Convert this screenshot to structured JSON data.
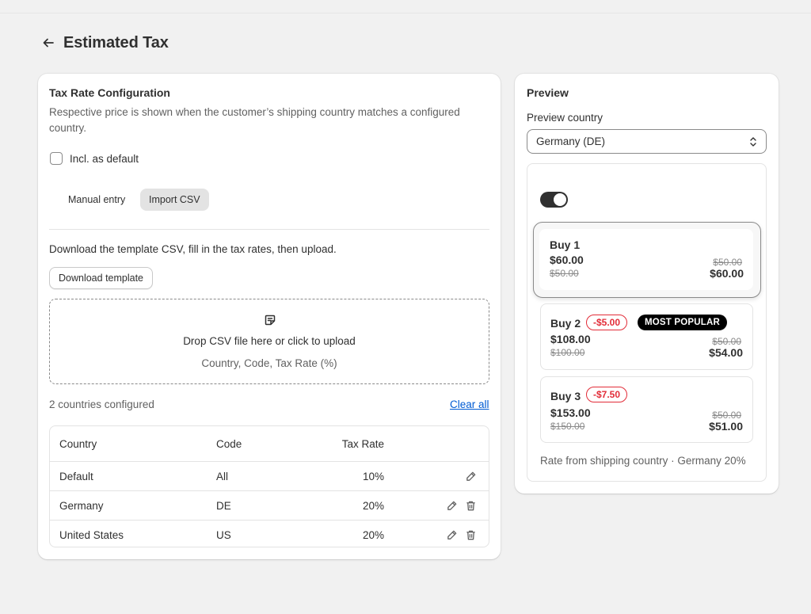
{
  "page": {
    "title": "Estimated Tax"
  },
  "config": {
    "title": "Tax Rate Configuration",
    "description": "Respective price is shown when the customer’s shipping country matches a configured country.",
    "incl_default_label": "Incl. as default",
    "incl_default_checked": false,
    "tabs": [
      {
        "label": "Manual entry",
        "active": false
      },
      {
        "label": "Import CSV",
        "active": true
      }
    ],
    "import_instructions": "Download the template CSV, fill in the tax rates, then upload.",
    "download_label": "Download template",
    "dropzone": {
      "text": "Drop CSV file here or click to upload",
      "hint": "Country, Code, Tax Rate (%)"
    },
    "count_text": "2 countries configured",
    "clear_all_label": "Clear all",
    "table": {
      "headers": {
        "country": "Country",
        "code": "Code",
        "rate": "Tax Rate"
      },
      "rows": [
        {
          "country": "Default",
          "code": "All",
          "rate": "10%"
        },
        {
          "country": "Germany",
          "code": "DE",
          "rate": "20%"
        },
        {
          "country": "United States",
          "code": "US",
          "rate": "20%"
        }
      ]
    }
  },
  "preview": {
    "title": "Preview",
    "country_label": "Preview country",
    "country_value": "Germany (DE)",
    "toggle_on": true,
    "offers": [
      {
        "title": "Buy 1",
        "price": "$60.00",
        "original": "$50.00",
        "compare": "$50.00",
        "unit": "$60.00",
        "discount": "",
        "popular": ""
      },
      {
        "title": "Buy 2",
        "price": "$108.00",
        "original": "$100.00",
        "compare": "$50.00",
        "unit": "$54.00",
        "discount": "-$5.00",
        "popular": "MOST POPULAR"
      },
      {
        "title": "Buy 3",
        "price": "$153.00",
        "original": "$150.00",
        "compare": "$50.00",
        "unit": "$51.00",
        "discount": "-$7.50",
        "popular": ""
      }
    ],
    "footer": "Rate from shipping country · Germany 20%"
  },
  "colors": {
    "accent_link": "#005bd3",
    "discount_red": "#e22c38",
    "popular_bg": "#000000",
    "toggle_on": "#303030"
  },
  "icons": [
    "arrow-left-icon",
    "note-icon",
    "pencil-icon",
    "trash-icon",
    "select-chevrons-icon"
  ]
}
